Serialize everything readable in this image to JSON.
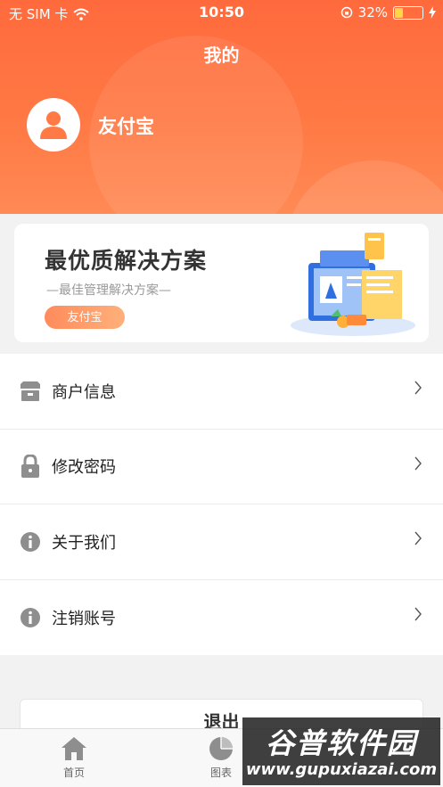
{
  "status_bar": {
    "carrier": "无 SIM 卡",
    "time": "10:50",
    "battery": "32%",
    "battery_level": 0.32
  },
  "header": {
    "title": "我的",
    "username": "友付宝"
  },
  "banner": {
    "title": "最优质解决方案",
    "subtitle": "—最佳管理解决方案—",
    "button_label": "友付宝"
  },
  "menu": {
    "items": [
      {
        "label": "商户信息",
        "icon": "store-icon"
      },
      {
        "label": "修改密码",
        "icon": "lock-icon"
      },
      {
        "label": "关于我们",
        "icon": "info-icon"
      },
      {
        "label": "注销账号",
        "icon": "info-icon"
      }
    ]
  },
  "logout": {
    "label": "退出"
  },
  "tabbar": {
    "tabs": [
      {
        "label": "首页",
        "icon": "home-icon"
      },
      {
        "label": "图表",
        "icon": "pie-chart-icon"
      }
    ]
  },
  "watermark": {
    "name": "谷普软件园",
    "url": "www.gupuxiazai.com"
  },
  "colors": {
    "accent": "#ff6a3d",
    "battery_fill": "#ffd54a"
  }
}
